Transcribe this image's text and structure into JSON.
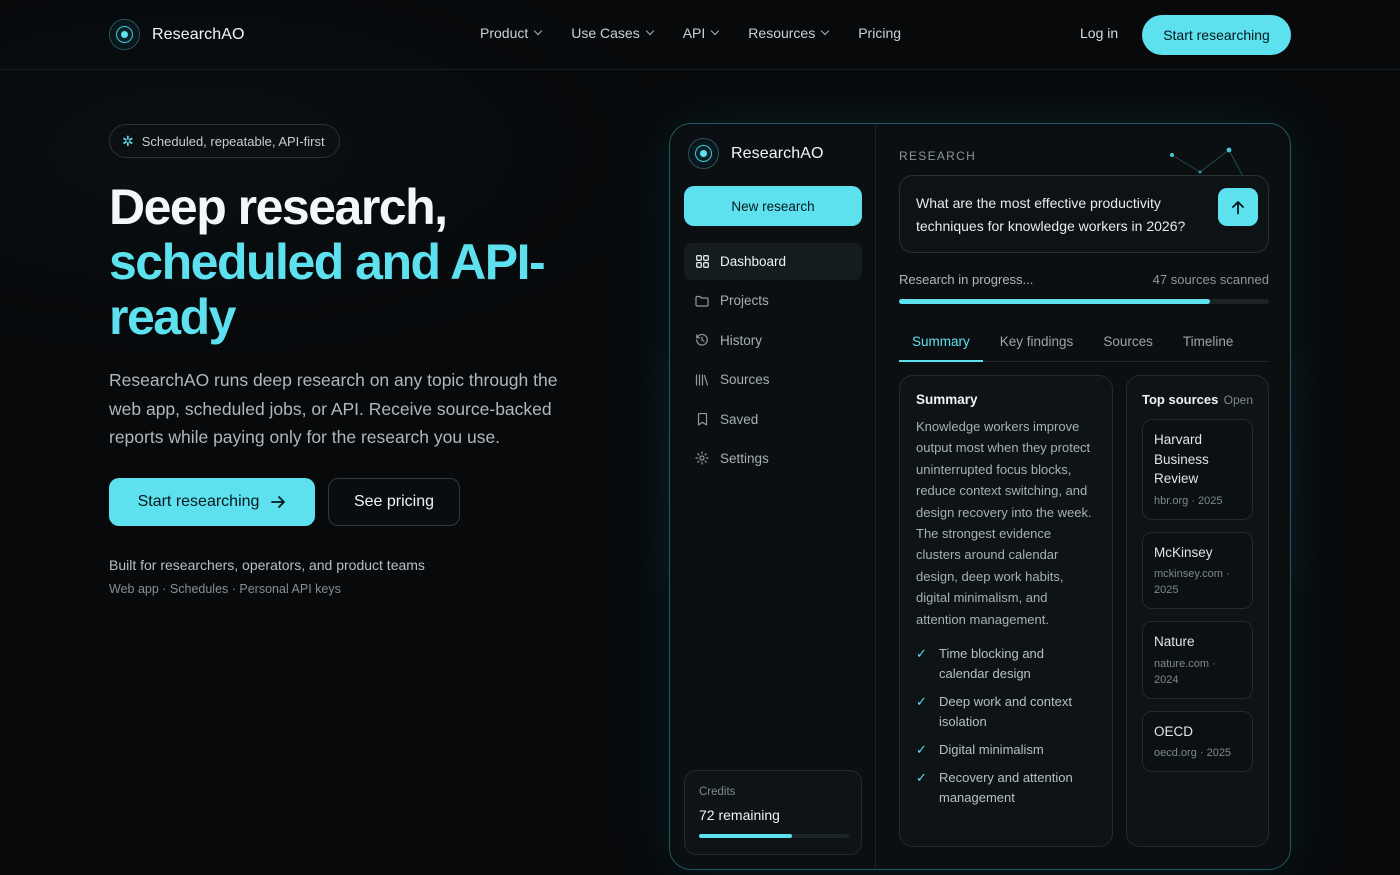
{
  "nav": {
    "brand": "ResearchAO",
    "links": [
      {
        "label": "Product",
        "dropdown": true
      },
      {
        "label": "Use Cases",
        "dropdown": true
      },
      {
        "label": "API",
        "dropdown": true
      },
      {
        "label": "Resources",
        "dropdown": true
      },
      {
        "label": "Pricing",
        "dropdown": false
      }
    ],
    "login": "Log in",
    "cta": "Start researching"
  },
  "hero": {
    "badge": "Scheduled, repeatable, API-first",
    "title_line1": "Deep research,",
    "title_line2": "scheduled and API-",
    "title_line3": "ready",
    "lead": "ResearchAO runs deep research on any topic through the web app, scheduled jobs, or API. Receive source-backed reports while paying only for the research you use.",
    "primary_button": "Start researching",
    "secondary_button": "See pricing",
    "built_for": "Built for researchers, operators, and product teams",
    "built_sub": "Web app · Schedules · Personal API keys"
  },
  "app": {
    "brand": "ResearchAO",
    "new_research": "New research",
    "sidebar": [
      {
        "label": "Dashboard",
        "icon": "grid-icon",
        "active": true
      },
      {
        "label": "Projects",
        "icon": "folder-icon",
        "active": false
      },
      {
        "label": "History",
        "icon": "history-icon",
        "active": false
      },
      {
        "label": "Sources",
        "icon": "library-icon",
        "active": false
      },
      {
        "label": "Saved",
        "icon": "bookmark-icon",
        "active": false
      },
      {
        "label": "Settings",
        "icon": "gear-icon",
        "active": false
      }
    ],
    "credits": {
      "label": "Credits",
      "value": "72 remaining",
      "fraction": 0.62
    },
    "research_label": "RESEARCH",
    "query": "What are the most effective productivity techniques for knowledge workers in 2026?",
    "progress": {
      "label": "Research in progress...",
      "count": "47 sources scanned",
      "fraction": 0.84
    },
    "tabs": [
      "Summary",
      "Key findings",
      "Sources",
      "Timeline"
    ],
    "active_tab": 0,
    "summary": {
      "title": "Summary",
      "body": "Knowledge workers improve output most when they protect uninterrupted focus blocks, reduce context switching, and design recovery into the week. The strongest evidence clusters around calendar design, deep work habits, digital minimalism, and attention management.",
      "findings": [
        "Time blocking and calendar design",
        "Deep work and context isolation",
        "Digital minimalism",
        "Recovery and attention management"
      ]
    },
    "sources": {
      "title": "Top sources",
      "open": "Open",
      "items": [
        {
          "name": "Harvard Business Review",
          "meta": "hbr.org · 2025"
        },
        {
          "name": "McKinsey",
          "meta": "mckinsey.com · 2025"
        },
        {
          "name": "Nature",
          "meta": "nature.com · 2024"
        },
        {
          "name": "OECD",
          "meta": "oecd.org · 2025"
        }
      ]
    }
  },
  "colors": {
    "accent": "#5ee1ef",
    "background": "#07090b"
  }
}
